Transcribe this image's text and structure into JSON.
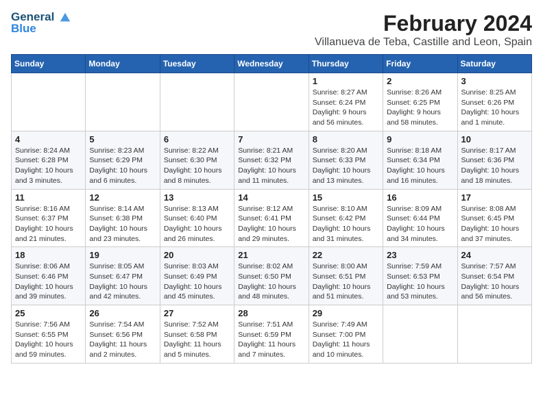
{
  "logo": {
    "line1": "General",
    "line2": "Blue"
  },
  "title": "February 2024",
  "subtitle": "Villanueva de Teba, Castille and Leon, Spain",
  "weekdays": [
    "Sunday",
    "Monday",
    "Tuesday",
    "Wednesday",
    "Thursday",
    "Friday",
    "Saturday"
  ],
  "weeks": [
    [
      {
        "day": "",
        "detail": ""
      },
      {
        "day": "",
        "detail": ""
      },
      {
        "day": "",
        "detail": ""
      },
      {
        "day": "",
        "detail": ""
      },
      {
        "day": "1",
        "detail": "Sunrise: 8:27 AM\nSunset: 6:24 PM\nDaylight: 9 hours\nand 56 minutes."
      },
      {
        "day": "2",
        "detail": "Sunrise: 8:26 AM\nSunset: 6:25 PM\nDaylight: 9 hours\nand 58 minutes."
      },
      {
        "day": "3",
        "detail": "Sunrise: 8:25 AM\nSunset: 6:26 PM\nDaylight: 10 hours\nand 1 minute."
      }
    ],
    [
      {
        "day": "4",
        "detail": "Sunrise: 8:24 AM\nSunset: 6:28 PM\nDaylight: 10 hours\nand 3 minutes."
      },
      {
        "day": "5",
        "detail": "Sunrise: 8:23 AM\nSunset: 6:29 PM\nDaylight: 10 hours\nand 6 minutes."
      },
      {
        "day": "6",
        "detail": "Sunrise: 8:22 AM\nSunset: 6:30 PM\nDaylight: 10 hours\nand 8 minutes."
      },
      {
        "day": "7",
        "detail": "Sunrise: 8:21 AM\nSunset: 6:32 PM\nDaylight: 10 hours\nand 11 minutes."
      },
      {
        "day": "8",
        "detail": "Sunrise: 8:20 AM\nSunset: 6:33 PM\nDaylight: 10 hours\nand 13 minutes."
      },
      {
        "day": "9",
        "detail": "Sunrise: 8:18 AM\nSunset: 6:34 PM\nDaylight: 10 hours\nand 16 minutes."
      },
      {
        "day": "10",
        "detail": "Sunrise: 8:17 AM\nSunset: 6:36 PM\nDaylight: 10 hours\nand 18 minutes."
      }
    ],
    [
      {
        "day": "11",
        "detail": "Sunrise: 8:16 AM\nSunset: 6:37 PM\nDaylight: 10 hours\nand 21 minutes."
      },
      {
        "day": "12",
        "detail": "Sunrise: 8:14 AM\nSunset: 6:38 PM\nDaylight: 10 hours\nand 23 minutes."
      },
      {
        "day": "13",
        "detail": "Sunrise: 8:13 AM\nSunset: 6:40 PM\nDaylight: 10 hours\nand 26 minutes."
      },
      {
        "day": "14",
        "detail": "Sunrise: 8:12 AM\nSunset: 6:41 PM\nDaylight: 10 hours\nand 29 minutes."
      },
      {
        "day": "15",
        "detail": "Sunrise: 8:10 AM\nSunset: 6:42 PM\nDaylight: 10 hours\nand 31 minutes."
      },
      {
        "day": "16",
        "detail": "Sunrise: 8:09 AM\nSunset: 6:44 PM\nDaylight: 10 hours\nand 34 minutes."
      },
      {
        "day": "17",
        "detail": "Sunrise: 8:08 AM\nSunset: 6:45 PM\nDaylight: 10 hours\nand 37 minutes."
      }
    ],
    [
      {
        "day": "18",
        "detail": "Sunrise: 8:06 AM\nSunset: 6:46 PM\nDaylight: 10 hours\nand 39 minutes."
      },
      {
        "day": "19",
        "detail": "Sunrise: 8:05 AM\nSunset: 6:47 PM\nDaylight: 10 hours\nand 42 minutes."
      },
      {
        "day": "20",
        "detail": "Sunrise: 8:03 AM\nSunset: 6:49 PM\nDaylight: 10 hours\nand 45 minutes."
      },
      {
        "day": "21",
        "detail": "Sunrise: 8:02 AM\nSunset: 6:50 PM\nDaylight: 10 hours\nand 48 minutes."
      },
      {
        "day": "22",
        "detail": "Sunrise: 8:00 AM\nSunset: 6:51 PM\nDaylight: 10 hours\nand 51 minutes."
      },
      {
        "day": "23",
        "detail": "Sunrise: 7:59 AM\nSunset: 6:53 PM\nDaylight: 10 hours\nand 53 minutes."
      },
      {
        "day": "24",
        "detail": "Sunrise: 7:57 AM\nSunset: 6:54 PM\nDaylight: 10 hours\nand 56 minutes."
      }
    ],
    [
      {
        "day": "25",
        "detail": "Sunrise: 7:56 AM\nSunset: 6:55 PM\nDaylight: 10 hours\nand 59 minutes."
      },
      {
        "day": "26",
        "detail": "Sunrise: 7:54 AM\nSunset: 6:56 PM\nDaylight: 11 hours\nand 2 minutes."
      },
      {
        "day": "27",
        "detail": "Sunrise: 7:52 AM\nSunset: 6:58 PM\nDaylight: 11 hours\nand 5 minutes."
      },
      {
        "day": "28",
        "detail": "Sunrise: 7:51 AM\nSunset: 6:59 PM\nDaylight: 11 hours\nand 7 minutes."
      },
      {
        "day": "29",
        "detail": "Sunrise: 7:49 AM\nSunset: 7:00 PM\nDaylight: 11 hours\nand 10 minutes."
      },
      {
        "day": "",
        "detail": ""
      },
      {
        "day": "",
        "detail": ""
      }
    ]
  ]
}
